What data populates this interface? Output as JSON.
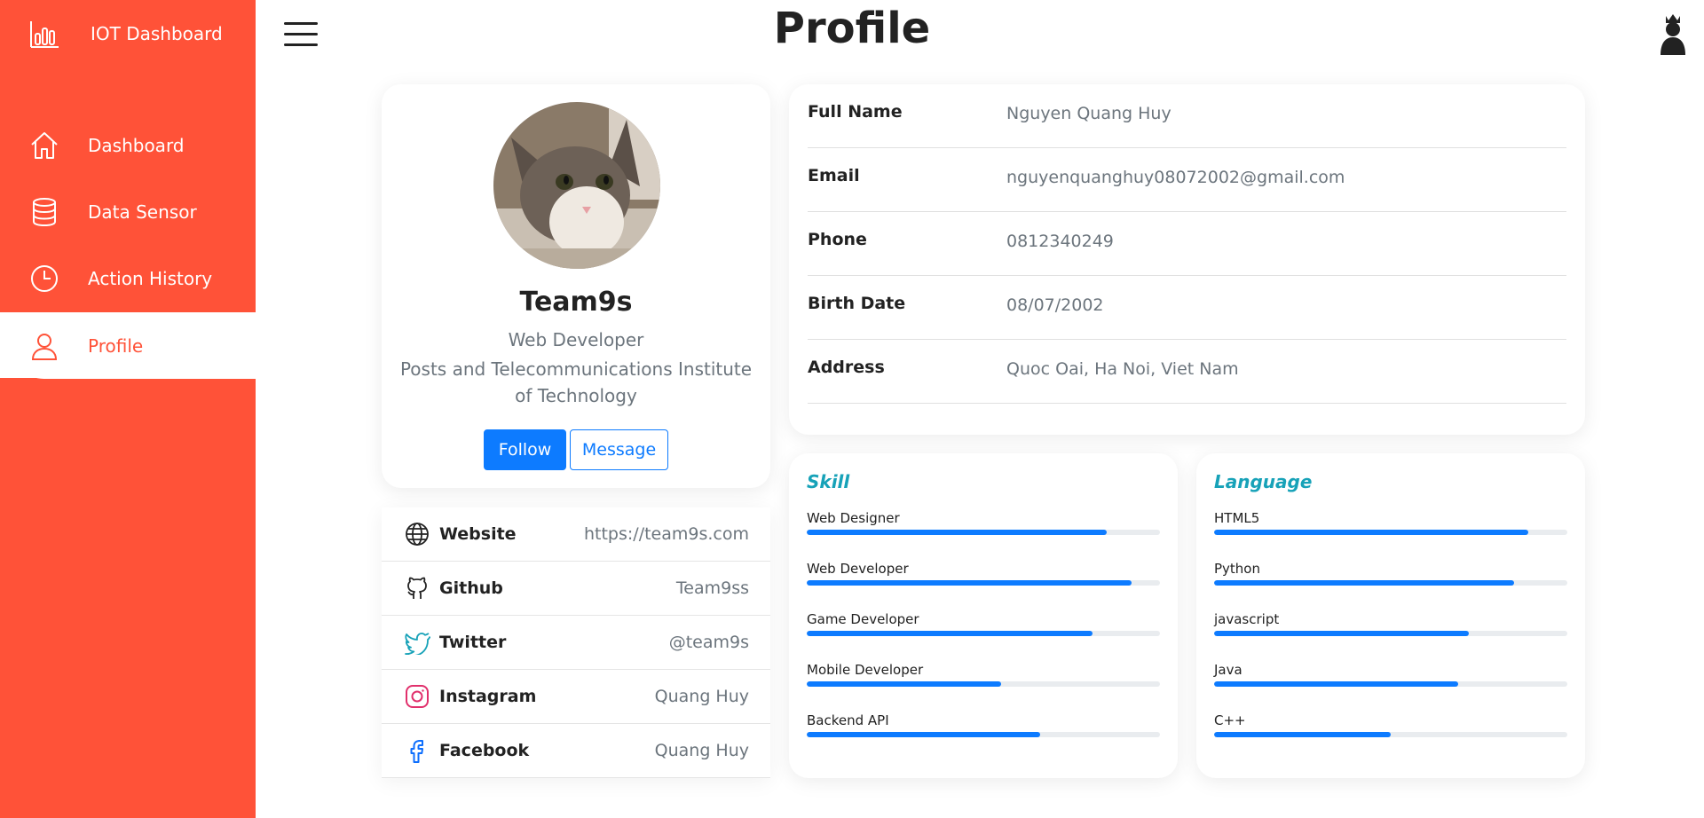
{
  "sidebar": {
    "brand": "IOT Dashboard",
    "items": [
      {
        "label": "Dashboard",
        "icon": "home-icon"
      },
      {
        "label": "Data Sensor",
        "icon": "database-icon"
      },
      {
        "label": "Action History",
        "icon": "clock-icon"
      },
      {
        "label": "Profile",
        "icon": "user-icon",
        "active": true
      }
    ]
  },
  "header": {
    "title": "Profile"
  },
  "profile": {
    "name": "Team9s",
    "role": "Web Developer",
    "organization": "Posts and Telecommunications Institute of Technology",
    "follow_label": "Follow",
    "message_label": "Message"
  },
  "social": [
    {
      "name": "Website",
      "value": "https://team9s.com",
      "icon": "globe-icon"
    },
    {
      "name": "Github",
      "value": "Team9ss",
      "icon": "github-icon"
    },
    {
      "name": "Twitter",
      "value": "@team9s",
      "icon": "twitter-icon"
    },
    {
      "name": "Instagram",
      "value": "Quang Huy",
      "icon": "instagram-icon"
    },
    {
      "name": "Facebook",
      "value": "Quang Huy",
      "icon": "facebook-icon"
    }
  ],
  "info": [
    {
      "label": "Full Name",
      "value": "Nguyen Quang Huy"
    },
    {
      "label": "Email",
      "value": "nguyenquanghuy08072002@gmail.com"
    },
    {
      "label": "Phone",
      "value": "0812340249"
    },
    {
      "label": "Birth Date",
      "value": "08/07/2002"
    },
    {
      "label": "Address",
      "value": "Quoc Oai, Ha Noi, Viet Nam"
    }
  ],
  "skills": {
    "title": "Skill",
    "items": [
      {
        "label": "Web Designer",
        "percent": 85
      },
      {
        "label": "Web Developer",
        "percent": 92
      },
      {
        "label": "Game Developer",
        "percent": 81
      },
      {
        "label": "Mobile Developer",
        "percent": 55
      },
      {
        "label": "Backend API",
        "percent": 66
      }
    ]
  },
  "languages": {
    "title": "Language",
    "items": [
      {
        "label": "HTML5",
        "percent": 89
      },
      {
        "label": "Python",
        "percent": 85
      },
      {
        "label": "javascript",
        "percent": 72
      },
      {
        "label": "Java",
        "percent": 69
      },
      {
        "label": "C++",
        "percent": 50
      }
    ]
  },
  "colors": {
    "sidebar": "#ff5238",
    "primary": "#0d7bff",
    "accent_title": "#17a2b8",
    "muted": "#6c757d"
  }
}
